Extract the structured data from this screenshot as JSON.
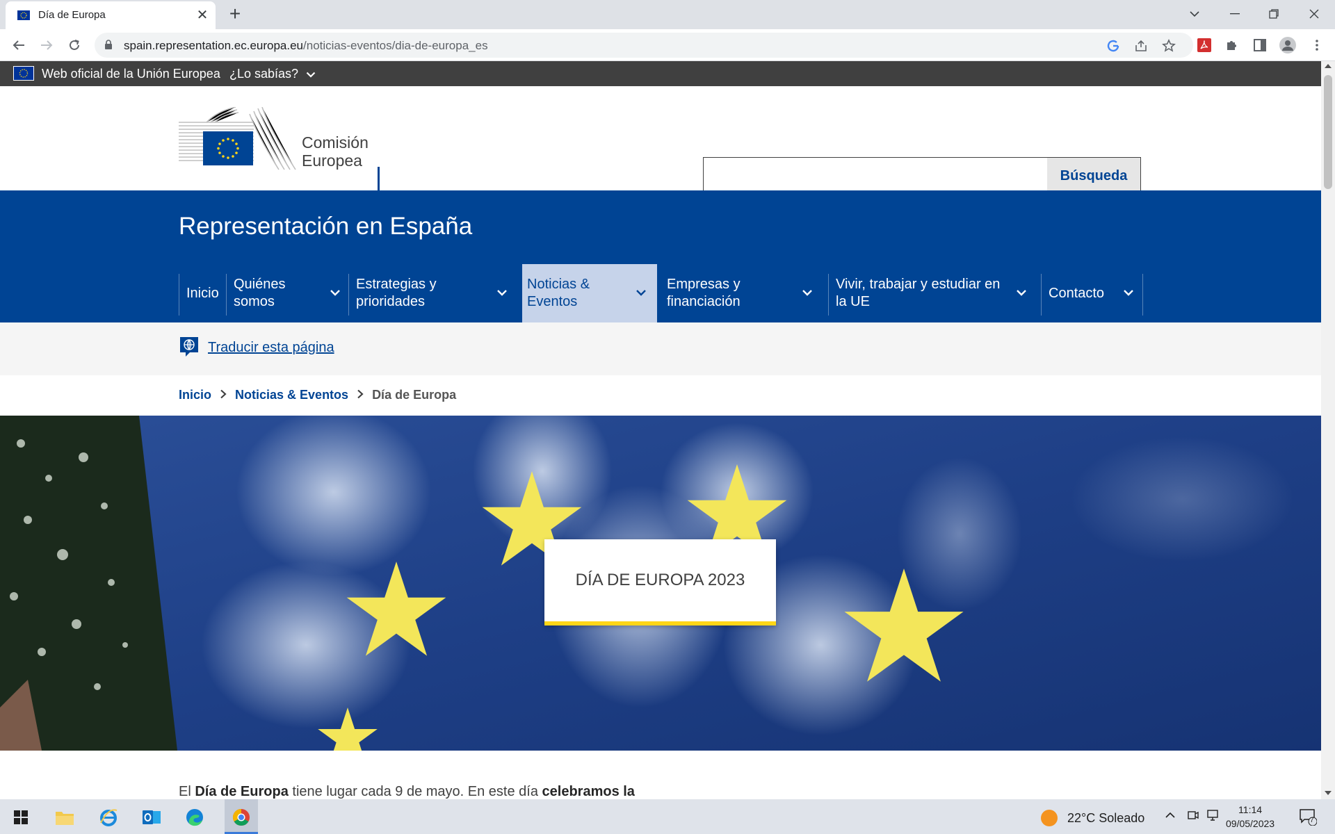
{
  "browser": {
    "tab_title": "Día de Europa",
    "url_host": "spain.representation.ec.europa.eu",
    "url_path": "/noticias-eventos/dia-de-europa_es"
  },
  "eu_bar": {
    "official_text": "Web oficial de la Unión Europea",
    "lo_sabias": "¿Lo sabías?"
  },
  "header": {
    "logo_line1": "Comisión",
    "logo_line2": "Europea",
    "search_button": "Búsqueda",
    "search_value": ""
  },
  "site": {
    "title": "Representación en España"
  },
  "menu": {
    "items": [
      {
        "line1": "Inicio",
        "line2": ""
      },
      {
        "line1": "Quiénes",
        "line2": "somos"
      },
      {
        "line1": "Estrategias y",
        "line2": "prioridades"
      },
      {
        "line1": "Noticias &",
        "line2": "Eventos"
      },
      {
        "line1": "Empresas y",
        "line2": "financiación"
      },
      {
        "line1": "Vivir, trabajar y estudiar en",
        "line2": "la UE"
      },
      {
        "line1": "Contacto",
        "line2": ""
      }
    ]
  },
  "translate": {
    "link": "Traducir esta página"
  },
  "breadcrumb": {
    "home": "Inicio",
    "section": "Noticias & Eventos",
    "current": "Día de Europa"
  },
  "hero": {
    "card_title": "DÍA DE EUROPA 2023"
  },
  "intro": {
    "part1": "El ",
    "bold1": "Día de Europa",
    "part2": " tiene lugar cada 9 de mayo. En este día ",
    "bold2": "celebramos la"
  },
  "taskbar": {
    "weather": "22°C  Soleado",
    "time": "11:14",
    "date": "09/05/2023",
    "notifications": "7"
  },
  "colors": {
    "ec_blue": "#004494",
    "eu_yellow": "#ffd617",
    "topbar_gray": "#404040"
  }
}
